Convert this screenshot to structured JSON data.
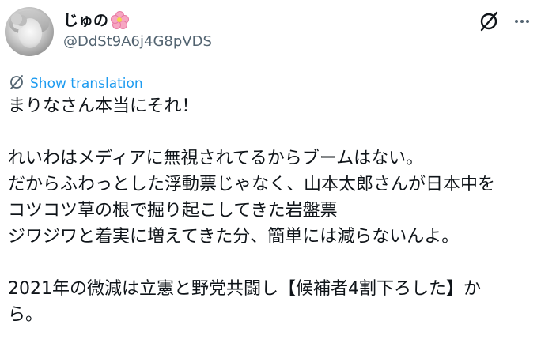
{
  "user": {
    "display_name": "じゅの",
    "handle": "@DdSt9A6j4G8pVDS"
  },
  "icons": {
    "avatar": "profile-photo",
    "name_emoji": "cherry-blossom",
    "grok": "grok-icon",
    "more": "more-icon",
    "translate": "translate-icon"
  },
  "translate_label": "Show translation",
  "tweet_lines": [
    "まりなさん本当にそれ！",
    "",
    "れいわはメディアに無視されてるからブームはない。",
    "だからふわっとした浮動票じゃなく、山本太郎さんが日本中を",
    "コツコツ草の根で掘り起こしてきた岩盤票",
    "ジワジワと着実に増えてきた分、簡単には減らないんよ。",
    "",
    "2021年の微減は立憲と野党共闘し【候補者4割下ろした】か",
    "ら。"
  ],
  "colors": {
    "text": "#0f1419",
    "secondary": "#536471",
    "link": "#1d9bf0"
  }
}
